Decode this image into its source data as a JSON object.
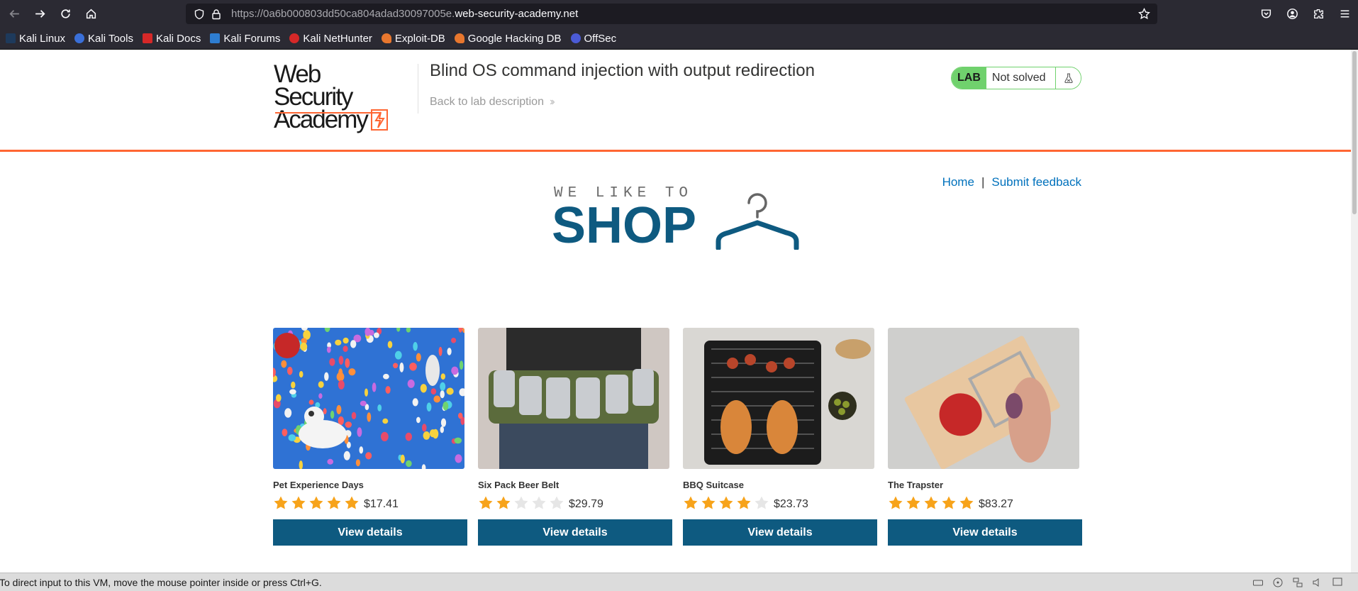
{
  "browser": {
    "url_prefix": "https://0a6b000803dd50ca804adad30097005e.",
    "url_domain": "web-security-academy.net",
    "bookmarks": [
      {
        "label": "Kali Linux",
        "color": "#2e7dd1"
      },
      {
        "label": "Kali Tools",
        "color": "#3a6fd8"
      },
      {
        "label": "Kali Docs",
        "color": "#d62828"
      },
      {
        "label": "Kali Forums",
        "color": "#2e7dd1"
      },
      {
        "label": "Kali NetHunter",
        "color": "#d62828"
      },
      {
        "label": "Exploit-DB",
        "color": "#e8772e"
      },
      {
        "label": "Google Hacking DB",
        "color": "#e8772e"
      },
      {
        "label": "OffSec",
        "color": "#4b5bd6"
      }
    ]
  },
  "header": {
    "logo_line1": "Web Security",
    "logo_line2": "Academy",
    "lab_title": "Blind OS command injection with output redirection",
    "back_link": "Back to lab description",
    "lab_badge": "LAB",
    "lab_status": "Not solved"
  },
  "nav": {
    "home": "Home",
    "separator": "|",
    "feedback": "Submit feedback"
  },
  "banner": {
    "tagline": "WE LIKE TO",
    "word": "SHOP"
  },
  "products": [
    {
      "name": "Pet Experience Days",
      "rating": 5,
      "price": "$17.41",
      "button": "View details"
    },
    {
      "name": "Six Pack Beer Belt",
      "rating": 2,
      "price": "$29.79",
      "button": "View details"
    },
    {
      "name": "BBQ Suitcase",
      "rating": 4,
      "price": "$23.73",
      "button": "View details"
    },
    {
      "name": "The Trapster",
      "rating": 5,
      "price": "$83.27",
      "button": "View details"
    }
  ],
  "statusbar": {
    "message": "To direct input to this VM, move the mouse pointer inside or press Ctrl+G."
  },
  "colors": {
    "accent": "#ff6633",
    "button": "#0e5a80",
    "link": "#0071bc",
    "lab_green": "#70d16d",
    "star": "#f7a31a"
  }
}
